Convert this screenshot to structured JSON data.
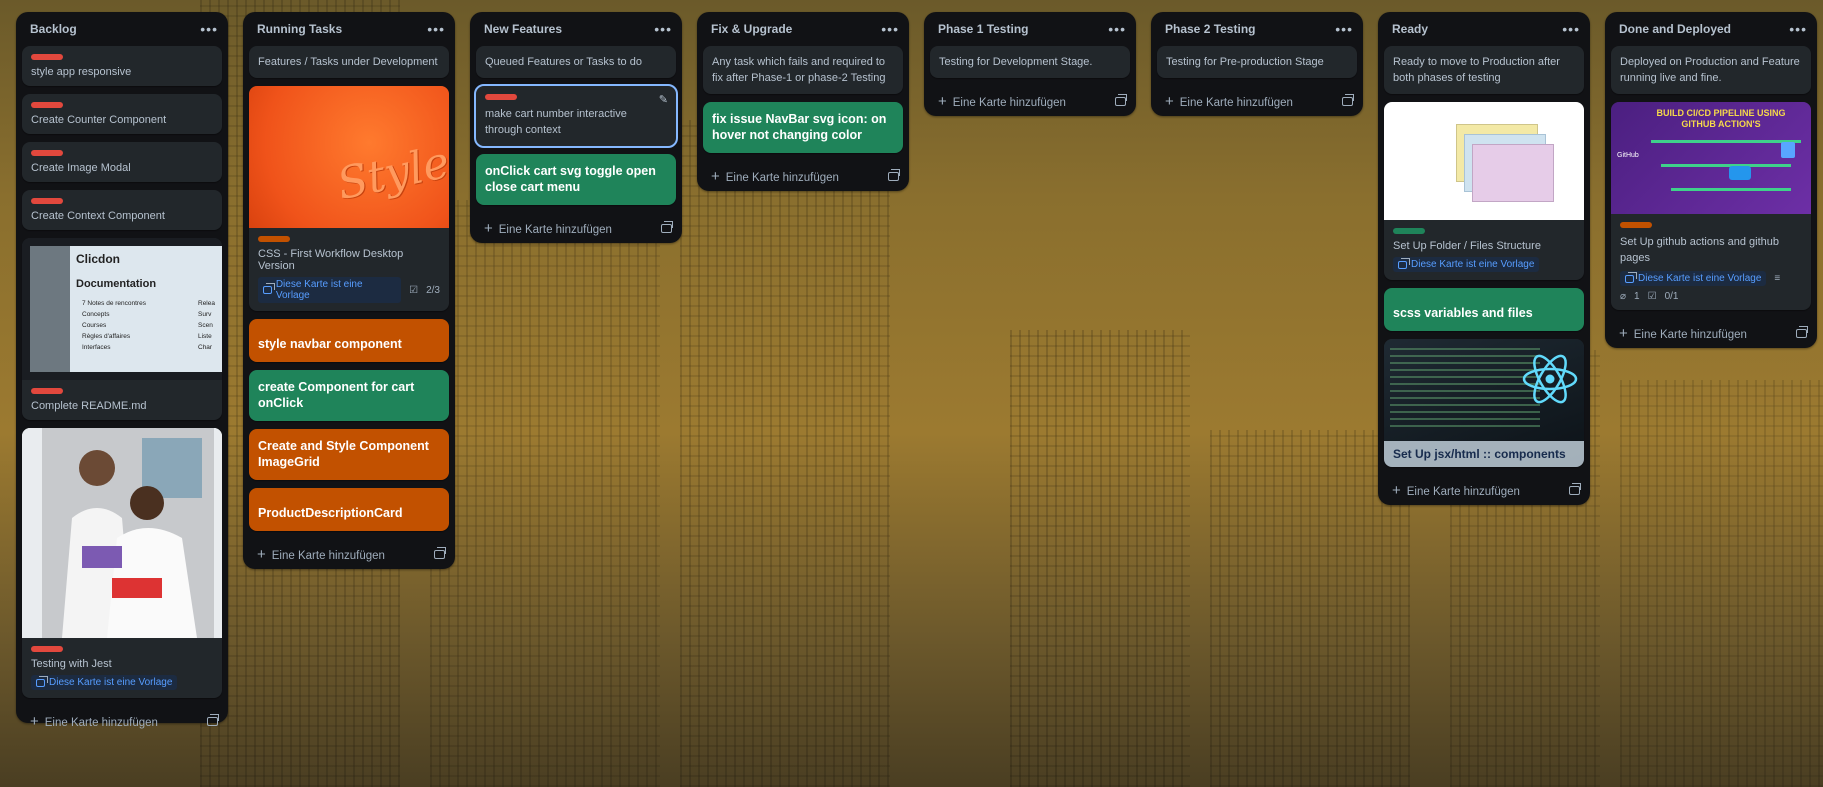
{
  "add_card_label": "Eine Karte hinzufügen",
  "template_badge": "Diese Karte ist eine Vorlage",
  "colors": {
    "red_label": "#e2483d",
    "green_label": "#1f845a",
    "orange_label": "#c25100",
    "list_bg": "#111215",
    "card_bg": "#22272b"
  },
  "lists": {
    "backlog": {
      "title": "Backlog",
      "cards": [
        "style app responsive",
        "Create Counter Component",
        "Create Image Modal",
        "Create Context Component",
        "Complete README.md",
        "Testing with Jest"
      ],
      "readme_cover": {
        "title": "Clicdon",
        "heading": "Documentation",
        "items": [
          "7 Notes de rencontres",
          "Concepts",
          "Courses",
          "Règles d'affaires",
          "Interfaces"
        ],
        "right_items": [
          "Relea",
          "Surv",
          "Scen",
          "Liste",
          "Char"
        ]
      }
    },
    "running": {
      "title": "Running Tasks",
      "description": "Features / Tasks under Development",
      "cover_text": "Style",
      "first_card": "CSS - First Workflow Desktop Version",
      "checklist": "2/3",
      "cards": [
        "style navbar component",
        "create Component for cart onClick",
        "Create and Style Component ImageGrid",
        "ProductDescriptionCard"
      ]
    },
    "new_features": {
      "title": "New Features",
      "description": "Queued Features or Tasks to do",
      "cards": [
        "make cart number interactive through context",
        "onClick cart svg toggle open close cart menu"
      ]
    },
    "fix": {
      "title": "Fix & Upgrade",
      "description": "Any task which fails and required to fix after Phase-1 or phase-2 Testing",
      "cards": [
        "fix issue NavBar svg icon: on hover not changing color"
      ]
    },
    "phase1": {
      "title": "Phase 1 Testing",
      "description": "Testing for Development Stage."
    },
    "phase2": {
      "title": "Phase 2 Testing",
      "description": "Testing for Pre-production Stage"
    },
    "ready": {
      "title": "Ready",
      "description": "Ready to move to Production after both phases of testing",
      "cards": [
        "Set Up Folder / Files Structure",
        "scss variables and files",
        "Set Up jsx/html :: components"
      ]
    },
    "done": {
      "title": "Done and Deployed",
      "description": "Deployed on Production and Feature running live and fine.",
      "cover_title": "BUILD CI/CD PIPELINE USING GITHUB ACTION'S",
      "cover_label": "GitHub",
      "card": "Set Up github actions and github pages",
      "attachments": "1",
      "checklist": "0/1"
    }
  }
}
